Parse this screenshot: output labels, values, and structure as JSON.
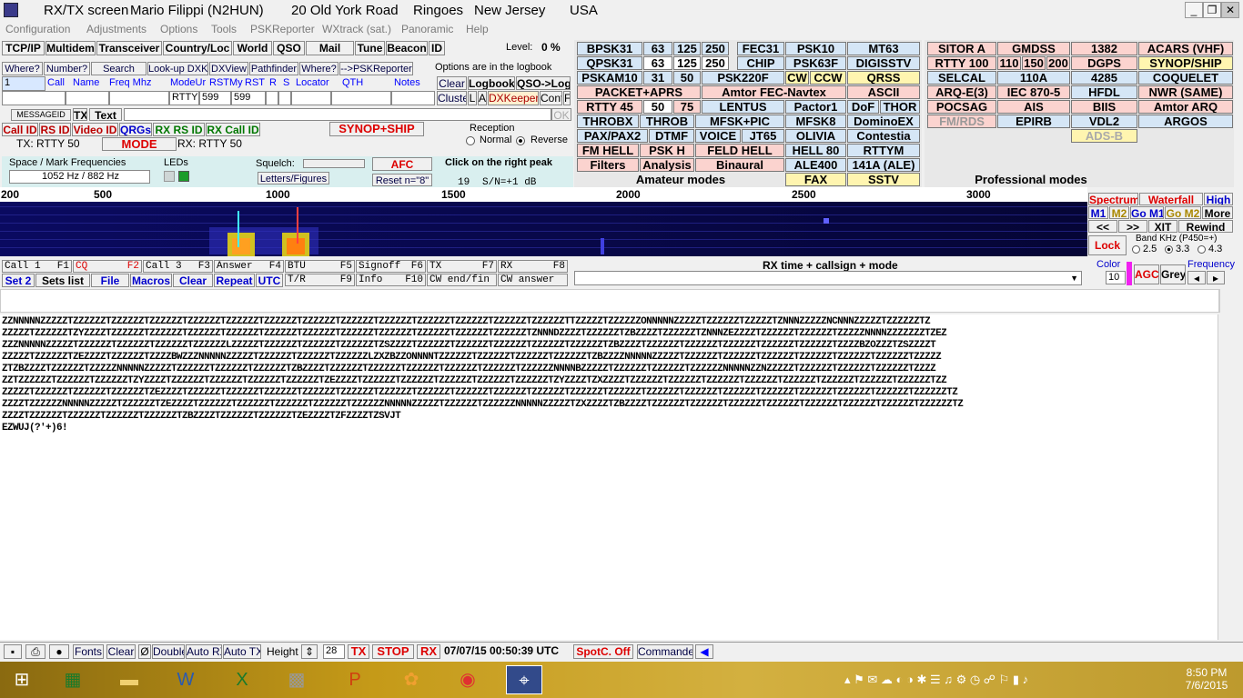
{
  "window": {
    "title_parts": [
      "RX/TX screen",
      "Mario Filippi (N2HUN)",
      "20 Old York Road",
      "Ringoes",
      "New Jersey",
      "USA"
    ],
    "controls": {
      "minimize": "_",
      "restore": "❐",
      "close": "✕"
    }
  },
  "menu": [
    "Configuration",
    "Adjustments",
    "Options",
    "Tools",
    "PSKReporter",
    "WXtrack (sat.)",
    "Panoramic",
    "Help"
  ],
  "toolbar": {
    "buttons": [
      "TCP/IP",
      "Multidem",
      "Transceiver",
      "Country/Loc",
      "World",
      "QSO",
      "Mail",
      "Tune",
      "Beacon",
      "ID"
    ],
    "level_label": "Level:",
    "level_value": "0 %"
  },
  "log": {
    "buttons": [
      "Where?",
      "Number?",
      "Search",
      "Look-up DXK",
      "DXView",
      "Pathfinder",
      "Where?",
      "-->PSKReporter"
    ],
    "options_text": "Options are in the logbook",
    "columns": [
      "Call",
      "Name",
      "Freq Mhz",
      "ModeUr",
      "RSTMy",
      "RST",
      "R",
      "S",
      "Locator",
      "QTH",
      "Notes"
    ],
    "row_number": "1",
    "mode_value": "RTTY",
    "rst_ur": "599",
    "rst_my": "599",
    "right_buttons": [
      "Clear",
      "Logbook",
      "QSO->Log",
      "Cluster",
      "L",
      "A",
      "DXKeeper",
      "Cont",
      "F"
    ]
  },
  "tabs": {
    "messageid": "MESSAGEID",
    "tx": "TX",
    "text": "Text",
    "ok": "OK"
  },
  "idrow": {
    "callid": "Call ID",
    "rsid": "RS ID",
    "videoid": "Video ID",
    "qrgs": "QRGs",
    "rxrsid": "RX RS ID",
    "rxcallid": "RX Call ID",
    "synop": "SYNOP+SHIP"
  },
  "txrx": {
    "tx": "TX: RTTY 50",
    "mode": "MODE",
    "rx": "RX: RTTY 50"
  },
  "reception": {
    "label": "Reception",
    "normal": "Normal",
    "reverse": "Reverse"
  },
  "freqs": {
    "label": "Space / Mark Frequencies",
    "value": "1052 Hz / 882 Hz",
    "leds": "LEDs"
  },
  "squelch": {
    "label": "Squelch:",
    "afc": "AFC",
    "letters": "Letters/Figures",
    "reset": "Reset n=\"8\"",
    "peak": "Click on the right peak",
    "snr_num": "19",
    "snr": "S/N=+1 dB"
  },
  "amateur_modes": {
    "header": "Amateur modes",
    "rows": [
      [
        "BPSK31",
        "63",
        "125",
        "250",
        "FEC31",
        "PSK10",
        "MT63"
      ],
      [
        "QPSK31",
        "63",
        "125",
        "250",
        "CHIP",
        "PSK63F",
        "DIGISSTV"
      ],
      [
        "PSKAM10",
        "31",
        "50",
        "PSK220F",
        "CW",
        "CCW",
        "QRSS"
      ],
      [
        "PACKET+APRS",
        "Amtor FEC-Navtex",
        "ASCII"
      ],
      [
        "RTTY 45",
        "50",
        "75",
        "LENTUS",
        "Pactor1",
        "DoF",
        "THOR"
      ],
      [
        "THROBX",
        "THROB",
        "MFSK+PIC",
        "MFSK8",
        "DominoEX"
      ],
      [
        "PAX/PAX2",
        "DTMF",
        "VOICE",
        "JT65",
        "OLIVIA",
        "Contestia"
      ],
      [
        "FM HELL",
        "PSK H",
        "FELD HELL",
        "HELL 80",
        "RTTYM"
      ],
      [
        "Filters",
        "Analysis",
        "Binaural",
        "ALE400",
        "141A (ALE)"
      ],
      [
        "FAX",
        "SSTV"
      ]
    ]
  },
  "professional_modes": {
    "header": "Professional modes",
    "rows": [
      [
        "SITOR A",
        "GMDSS",
        "1382",
        "ACARS (VHF)"
      ],
      [
        "RTTY 100",
        "110",
        "150",
        "200",
        "DGPS",
        "SYNOP/SHIP"
      ],
      [
        "SELCAL",
        "110A",
        "4285",
        "COQUELET"
      ],
      [
        "ARQ-E(3)",
        "IEC 870-5",
        "HFDL",
        "NWR (SAME)"
      ],
      [
        "POCSAG",
        "AIS",
        "BIIS",
        "Amtor ARQ"
      ],
      [
        "FM/RDS",
        "EPIRB",
        "VDL2",
        "ARGOS"
      ],
      [
        "ADS-B"
      ]
    ]
  },
  "scale": {
    "ticks": [
      "200",
      "500",
      "1000",
      "1500",
      "2000",
      "2500",
      "3000"
    ]
  },
  "waterfall_ctrl": {
    "spectrum": "Spectrum",
    "waterfall": "Waterfall",
    "high": "High",
    "m1": "M1",
    "m2": "M2",
    "gom1": "Go M1",
    "gom2": "Go M2",
    "more": "More",
    "back": "<<",
    "fwd": ">>",
    "xit": "XIT",
    "rewind": "Rewind",
    "lock": "Lock",
    "band": "Band KHz (P450=+)",
    "b1": "2.5",
    "b2": "3.3",
    "b3": "4.3"
  },
  "macros": {
    "row1": [
      [
        "Call 1",
        "F1"
      ],
      [
        "CQ",
        "F2"
      ],
      [
        "Call 3",
        "F3"
      ],
      [
        "Answer",
        "F4"
      ],
      [
        "BTU",
        "F5"
      ],
      [
        "Signoff",
        "F6"
      ],
      [
        "TX",
        "F7"
      ],
      [
        "RX",
        "F8"
      ]
    ],
    "row2_buttons": [
      "Set 2",
      "Sets list",
      "File",
      "Macros",
      "Clear",
      "Repeat",
      "UTC"
    ],
    "row2_macros": [
      [
        "T/R",
        "F9"
      ],
      [
        "Info",
        "F10"
      ],
      [
        "CW end/fin",
        ""
      ],
      [
        "CW answer",
        ""
      ]
    ]
  },
  "rxinfo": {
    "header": "RX time + callsign + mode",
    "color_label": "Color",
    "color_value": "10",
    "agc": "AGC",
    "grey": "Grey",
    "freq": "Frequency"
  },
  "rx_lines": [
    "ZZNNNNNZZZZZTZZZZZZTZZZZZZTZZZZZZTZZZZZZTZZZZZZTZZZZZZTZZZZZZTZZZZZZTZZZZZZTZZZZZZTZZZZZZTZZZZZZTZZZZZZTTZZZZZTZZZZZZONNNNNZZZZZTZZZZZZTZZZZZTZNNNZZZZZNCNNNZZZZZTZZZZZZTZ",
    "ZZZZZTZZZZZZTZYZZZZTZZZZZZTZZZZZZTZZZZZZTZZZZZZTZZZZZZTZZZZZZTZZZZZZTZZZZZZTZZZZZZTZZZZZZTZZZZZZTZNNNDZZZZTZZZZZZTZBZZZZTZZZZZZTZNNNZEZZZZTZZZZZZTZZZZZZTZZZZZNNNNZZZZZZZTZEZ",
    "ZZZNNNNNZZZZZTZZZZZZTZZZZZZTZZZZZZTZZZZZZLZZZZZTZZZZZZTZZZZZZTZZZZZZTZSZZZZTZZZZZZTZZZZZZTZZZZZZTZZZZZZTZZZZZZTZBZZZZTZZZZZZTZZZZZZTZZZZZZTZZZZZZTZZZZZZTZZZZBZOZZZTZSZZZZT",
    "ZZZZZTZZZZZZTZEZZZZTZZZZZZTZZZZBWZZZNNNNNZZZZZTZZZZZZTZZZZZZTZZZZZZLZXZBZZONNNNTZZZZZZTZZZZZZTZZZZZZTZZZZZZTZBZZZZNNNNNZZZZZTZZZZZZTZZZZZZTZZZZZZTZZZZZZTZZZZZZTZZZZZZTZZZZZ",
    "ZTZBZZZZTZZZZZZTZZZZZNNNNNZZZZZTZZZZZZTZZZZZZTZZZZZZTZBZZZZTZZZZZZTZZZZZZTZZZZZZTZZZZZZTZZZZZZTZZZZZZNNNNBZZZZZTZZZZZZTZZZZZZTZZZZZZNNNNNZZNZZZZZTZZZZZZTZZZZZZTZZZZZZTZZZZ",
    "ZZTZZZZZZTZZZZZZTZZZZZZTZYZZZZTZZZZZZTZZZZZZTZZZZZZTZZZZZZTZEZZZZTZZZZZZTZZZZZZTZZZZZZTZZZZZZTZZZZZZTZYZZZZTZXZZZZTZZZZZZTZZZZZZTZZZZZZTZZZZZZTZZZZZZTZZZZZZTZZZZZZTZZZZZZTZZ",
    "ZZZZZTZZZZZZTZZZZZZTZZZZZZTZEZZZZTZZZZZZTZZZZZZTZZZZZZTZZZZZZTZZZZZZTZZZZZZTZZZZZZTZZZZZZTZZZZZZTZZZZZZTZZZZZZTZZZZZZTZZZZZZTZZZZZZTZZZZZZTZZZZZZTZZZZZZTZZZZZZTZZZZZZTZZZZZZTZ",
    "ZZZZTZZZZZZNNNNNZZZZZTZZZZZZTZEZZZZTZZZZZZTZZZZZZTZZZZZZTZZZZZZTZZZZZZNNNNNZZZZZTZZZZZZTZZZZZZNNNNNZZZZZTZXZZZZTZBZZZZTZZZZZZTZZZZZZTZZZZZZTZZZZZZTZZZZZZTZZZZZZTZZZZZZTZZZZZZTZ",
    "ZZZZTZZZZZZTZZZZZZTZZZZZZTZZZZZZTZBZZZZTZZZZZZTZZZZZZTZEZZZZTZFZZZZTZSVJT",
    "EZWUJ(?'+)6!"
  ],
  "statusbar": {
    "fonts": "Fonts",
    "clear": "Clear",
    "zero": "Ø",
    "double": "Double",
    "autorx": "Auto RX",
    "autotx": "Auto TX",
    "height_label": "Height",
    "height_value": "28",
    "tx": "TX",
    "stop": "STOP",
    "rx": "RX",
    "clock": "07/07/15 00:50:39 UTC",
    "spotc": "SpotC. Off",
    "commander": "Commander"
  },
  "taskbar": {
    "time": "8:50 PM",
    "date": "7/6/2015"
  }
}
